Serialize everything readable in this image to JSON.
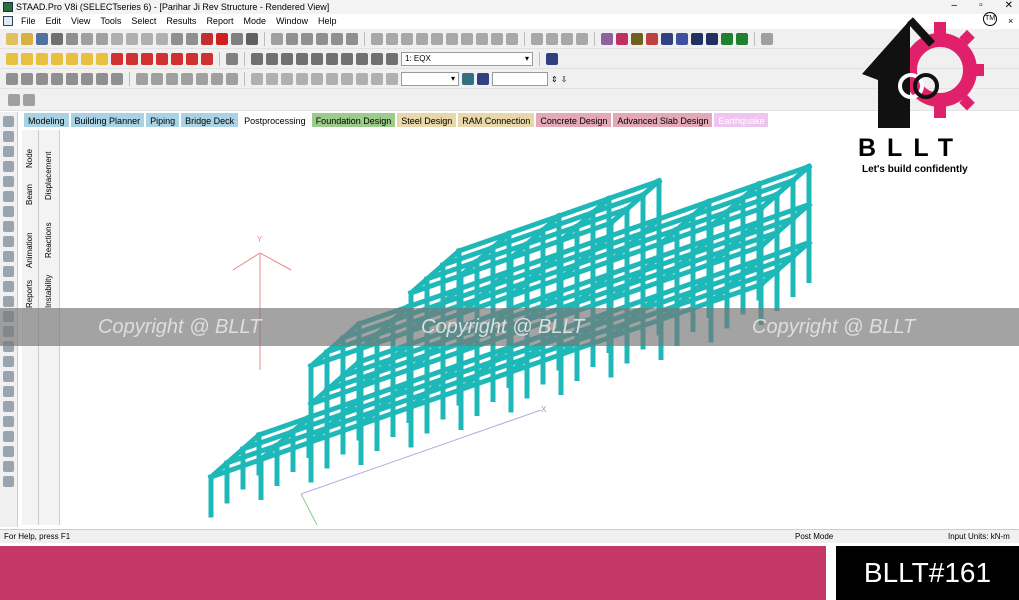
{
  "window": {
    "title": "STAAD.Pro V8i (SELECTseries 6) - [Parihar Ji Rev Structure - Rendered View]",
    "minimize": "–",
    "maximize": "▫",
    "close": "✕"
  },
  "menu": [
    "File",
    "Edit",
    "View",
    "Tools",
    "Select",
    "Results",
    "Report",
    "Mode",
    "Window",
    "Help"
  ],
  "menu_right": {
    "close": "×"
  },
  "toolbar": {
    "load_case": "1: EQX",
    "help_icon": "help-icon"
  },
  "tabs": [
    {
      "label": "Modeling",
      "color": "#a9d2e4"
    },
    {
      "label": "Building Planner",
      "color": "#a9d2e4"
    },
    {
      "label": "Piping",
      "color": "#a9d2e4"
    },
    {
      "label": "Bridge Deck",
      "color": "#a9d2e4"
    },
    {
      "label": "Postprocessing",
      "color": "#ffffff"
    },
    {
      "label": "Foundation Design",
      "color": "#9ccc8a"
    },
    {
      "label": "Steel Design",
      "color": "#e8d7a8"
    },
    {
      "label": "RAM Connection",
      "color": "#e8d7a8"
    },
    {
      "label": "Concrete Design",
      "color": "#e4a8b8"
    },
    {
      "label": "Advanced Slab Design",
      "color": "#e4a8b8"
    },
    {
      "label": "Earthquake",
      "color": "#f0c4f0"
    }
  ],
  "page_control": {
    "outer": [
      "Node",
      "Beam",
      "Animation",
      "Reports"
    ],
    "inner": [
      "Displacement",
      "Reactions",
      "Instability"
    ]
  },
  "viewport": {
    "axis_y": "Y",
    "axis_x": "X",
    "structure_color": "#1fb8b8"
  },
  "status": {
    "help": "For Help, press F1",
    "mode": "Post Mode",
    "units": "Input Units:   kN-m"
  },
  "watermark": [
    "Copyright @ BLLT",
    "Copyright @ BLLT",
    "Copyright @ BLLT"
  ],
  "logo": {
    "brand": "BLLT",
    "tagline": "Let's build confidently",
    "tm": "TM"
  },
  "badge": "BLLT#161"
}
